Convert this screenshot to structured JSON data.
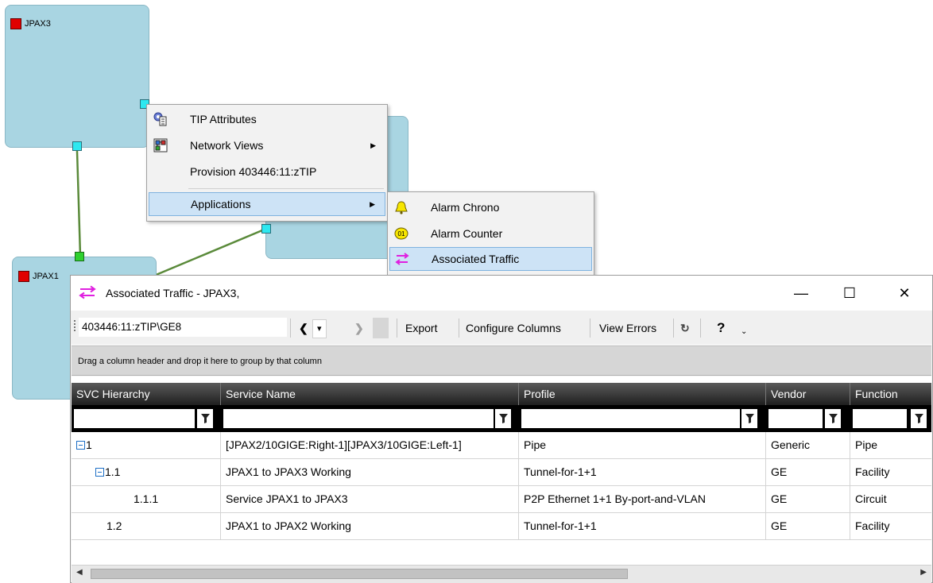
{
  "canvas": {
    "nodes": [
      {
        "label": "JPAX3"
      },
      {
        "label": "JPAX1"
      }
    ]
  },
  "context_menu": {
    "items": [
      {
        "label": "TIP Attributes",
        "icon": "tip-attributes-icon",
        "has_submenu": false
      },
      {
        "label": "Network Views",
        "icon": "network-views-icon",
        "has_submenu": true
      },
      {
        "label": "Provision 403446:11:zTIP",
        "icon": "",
        "has_submenu": false
      },
      {
        "label": "Applications",
        "icon": "",
        "has_submenu": true,
        "selected": true
      }
    ]
  },
  "submenu": {
    "items": [
      {
        "label": "Alarm Chrono",
        "icon": "bell-icon"
      },
      {
        "label": "Alarm Counter",
        "icon": "alarm-counter-icon"
      },
      {
        "label": "Associated Traffic",
        "icon": "associated-traffic-icon",
        "selected": true
      }
    ]
  },
  "window": {
    "title": "Associated Traffic - JPAX3,",
    "controls": {
      "minimize": "—",
      "maximize": "☐",
      "close": "✕"
    }
  },
  "toolbar": {
    "address": "403446:11:zTIP\\GE8",
    "back": "❮",
    "dropdown": "▾",
    "forward": "❯",
    "export": "Export",
    "configure_columns": "Configure Columns",
    "view_errors": "View Errors",
    "refresh": "↻",
    "help": "?",
    "overflow": "⌄"
  },
  "grid": {
    "group_hint": "Drag a column header and drop it here to group by that column",
    "columns": [
      "SVC Hierarchy",
      "Service Name",
      "Profile",
      "Vendor",
      "Function"
    ],
    "rows": [
      {
        "hierarchy": "1",
        "expander": true,
        "indent": 0,
        "service_name": "[JPAX2/10GIGE:Right-1][JPAX3/10GIGE:Left-1]",
        "profile": "Pipe",
        "vendor": "Generic",
        "function": "Pipe"
      },
      {
        "hierarchy": "1.1",
        "expander": true,
        "indent": 1,
        "service_name": "JPAX1 to JPAX3 Working",
        "profile": "Tunnel-for-1+1",
        "vendor": "GE",
        "function": "Facility"
      },
      {
        "hierarchy": "1.1.1",
        "expander": false,
        "indent": 2,
        "service_name": "Service JPAX1 to JPAX3",
        "profile": "P2P Ethernet 1+1 By-port-and-VLAN",
        "vendor": "GE",
        "function": "Circuit"
      },
      {
        "hierarchy": "1.2",
        "expander": false,
        "indent": 1,
        "service_name": "JPAX1 to JPAX2 Working",
        "profile": "Tunnel-for-1+1",
        "vendor": "GE",
        "function": "Facility"
      }
    ]
  },
  "colors": {
    "node_fill": "#a9d5e2",
    "port_cyan": "#2ee8f0",
    "port_green": "#2fd12f",
    "link_green": "#5a8a3a",
    "menu_selected": "#cde3f6"
  }
}
